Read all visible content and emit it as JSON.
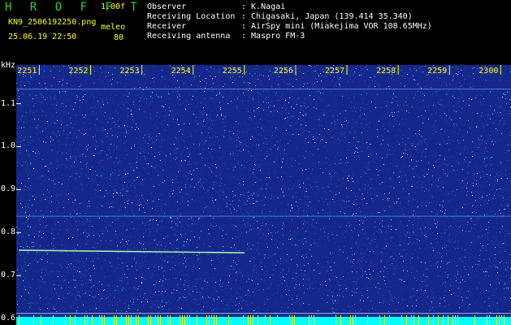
{
  "header": {
    "app_title": "H R O F F T",
    "version": "1.00f",
    "filename": "KN9_2506192250.png",
    "datetime": "25.06.19 22:50",
    "mode_label": "meleo",
    "mode_value": "80",
    "info": [
      {
        "label": "Observer",
        "value": ": K.Nagai"
      },
      {
        "label": "Receiving Location",
        "value": ": Chigasaki, Japan (139.414 35.340)"
      },
      {
        "label": "Receiver",
        "value": ": AirSpy mini (Miakejima VOR 108.65MHz)"
      },
      {
        "label": "Receiving antenna",
        "value": ": Maspro FM-3"
      }
    ]
  },
  "colors": {
    "background": "#000000",
    "spectrogram_base": "#14288c",
    "noise_bright": "#9fe7ff",
    "time_label": "#ffff00",
    "header_green": "#2fd02f",
    "bottom_band": "#00ffff"
  },
  "chart_data": {
    "type": "heatmap",
    "ylabel": "kHz",
    "y_ticks": [
      "1.1",
      "1.0",
      "0.9",
      "0.8",
      "0.7",
      "0.6"
    ],
    "y_tick_values": [
      1.1,
      1.0,
      0.9,
      0.8,
      0.7,
      0.6
    ],
    "ylim": [
      0.585,
      1.19
    ],
    "x_ticks": [
      "2251",
      "2252",
      "2253",
      "2254",
      "2255",
      "2256",
      "2257",
      "2258",
      "2259",
      "2300"
    ],
    "x_tick_values": [
      2251,
      2252,
      2253,
      2254,
      2255,
      2256,
      2257,
      2258,
      2259,
      2260
    ],
    "xlim": [
      2250.55,
      2260.2
    ],
    "carrier_lines_khz": [
      1.134,
      0.838,
      0.612,
      0.6
    ],
    "signal_trace": {
      "x": [
        2250.6,
        2255.0
      ],
      "y_khz": [
        0.759,
        0.753
      ]
    }
  }
}
